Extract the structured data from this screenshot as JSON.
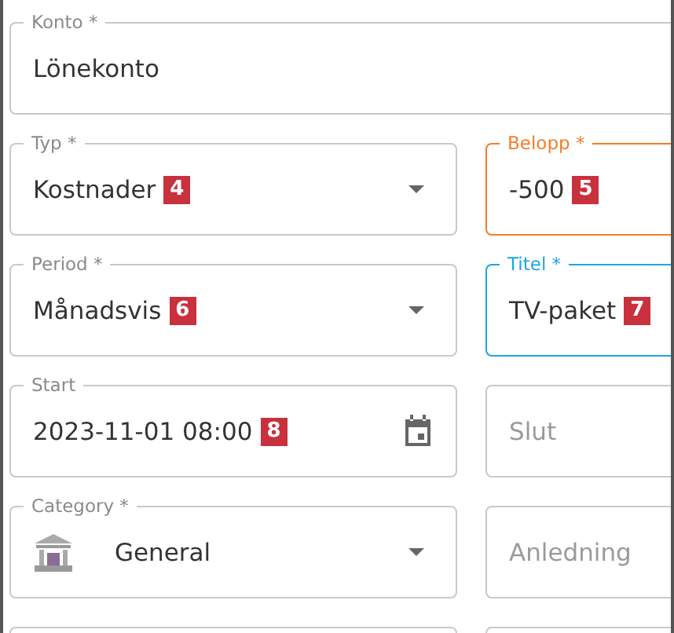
{
  "fields": [
    {
      "kind": "text",
      "label": "Konto *",
      "value": "Lönekonto",
      "wide": true
    },
    {
      "kind": "select",
      "label": "Typ *",
      "value": "Kostnader",
      "badge": "4"
    },
    {
      "kind": "text",
      "label": "Belopp *",
      "value": "-500",
      "badge": "5",
      "color": "#f57c26"
    },
    {
      "kind": "select",
      "label": "Period *",
      "value": "Månadsvis",
      "badge": "6"
    },
    {
      "kind": "text",
      "label": "Titel *",
      "value": "TV-paket",
      "badge": "7",
      "color": "#1ea5e0"
    },
    {
      "kind": "date",
      "label": "Start",
      "value": "2023-11-01 08:00",
      "badge": "8"
    },
    {
      "kind": "text",
      "placeholder": "Slut"
    },
    {
      "kind": "category",
      "label": "Category *",
      "value": "General"
    },
    {
      "kind": "text",
      "placeholder": "Anledning"
    },
    {
      "kind": "blank"
    },
    {
      "kind": "blank"
    }
  ]
}
